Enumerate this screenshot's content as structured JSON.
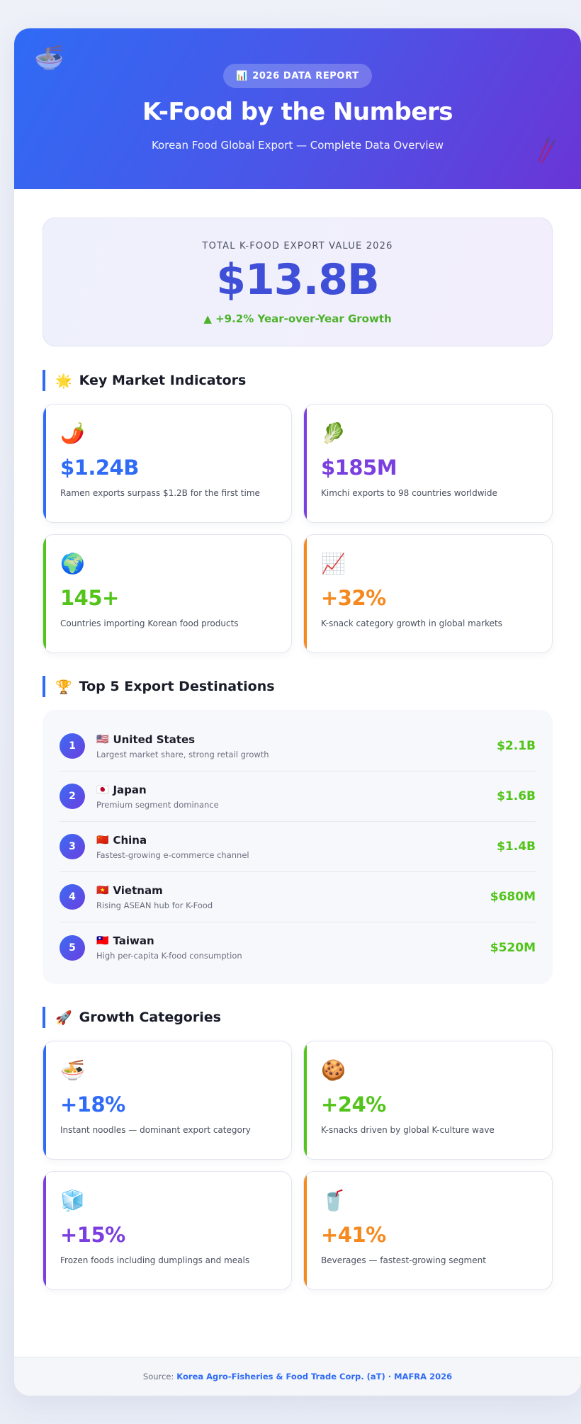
{
  "hero": {
    "badge_icon": "📊",
    "badge": "2026 DATA REPORT",
    "title": "K-Food by the Numbers",
    "subtitle": "Korean Food Global Export — Complete Data Overview",
    "deco_left": "🍜",
    "deco_right": "🥢"
  },
  "total": {
    "label": "TOTAL K-FOOD EXPORT VALUE 2026",
    "value": "$13.8B",
    "growth": "▲ +9.2% Year-over-Year Growth"
  },
  "indicators": {
    "title_icon": "🌟",
    "title": "Key Market Indicators",
    "items": [
      {
        "icon": "🌶️",
        "value": "$1.24B",
        "desc": "Ramen exports surpass $1.2B for the first time",
        "accent": "#2f6bf5"
      },
      {
        "icon": "🥬",
        "value": "$185M",
        "desc": "Kimchi exports to 98 countries worldwide",
        "accent": "#7b3fe0"
      },
      {
        "icon": "🌍",
        "value": "145+",
        "desc": "Countries importing Korean food products",
        "accent": "#52c41a"
      },
      {
        "icon": "📈",
        "value": "+32%",
        "desc": "K-snack category growth in global markets",
        "accent": "#f5891e"
      }
    ]
  },
  "destinations": {
    "title_icon": "🏆",
    "title": "Top 5 Export Destinations",
    "items": [
      {
        "rank": "1",
        "flag": "🇺🇸",
        "name": "United States",
        "desc": "Largest market share, strong retail growth",
        "value": "$2.1B"
      },
      {
        "rank": "2",
        "flag": "🇯🇵",
        "name": "Japan",
        "desc": "Premium segment dominance",
        "value": "$1.6B"
      },
      {
        "rank": "3",
        "flag": "🇨🇳",
        "name": "China",
        "desc": "Fastest-growing e-commerce channel",
        "value": "$1.4B"
      },
      {
        "rank": "4",
        "flag": "🇻🇳",
        "name": "Vietnam",
        "desc": "Rising ASEAN hub for K-Food",
        "value": "$680M"
      },
      {
        "rank": "5",
        "flag": "🇹🇼",
        "name": "Taiwan",
        "desc": "High per-capita K-food consumption",
        "value": "$520M"
      }
    ]
  },
  "growth": {
    "title_icon": "🚀",
    "title": "Growth Categories",
    "items": [
      {
        "icon": "🍜",
        "value": "+18%",
        "desc": "Instant noodles — dominant export category",
        "accent": "#2f6bf5"
      },
      {
        "icon": "🍪",
        "value": "+24%",
        "desc": "K-snacks driven by global K-culture wave",
        "accent": "#52c41a"
      },
      {
        "icon": "🧊",
        "value": "+15%",
        "desc": "Frozen foods including dumplings and meals",
        "accent": "#7b3fe0"
      },
      {
        "icon": "🥤",
        "value": "+41%",
        "desc": "Beverages — fastest-growing segment",
        "accent": "#f5891e"
      }
    ]
  },
  "footer": {
    "prefix": "Source:",
    "source": "Korea Agro-Fisheries & Food Trade Corp. (aT) · MAFRA 2026"
  }
}
